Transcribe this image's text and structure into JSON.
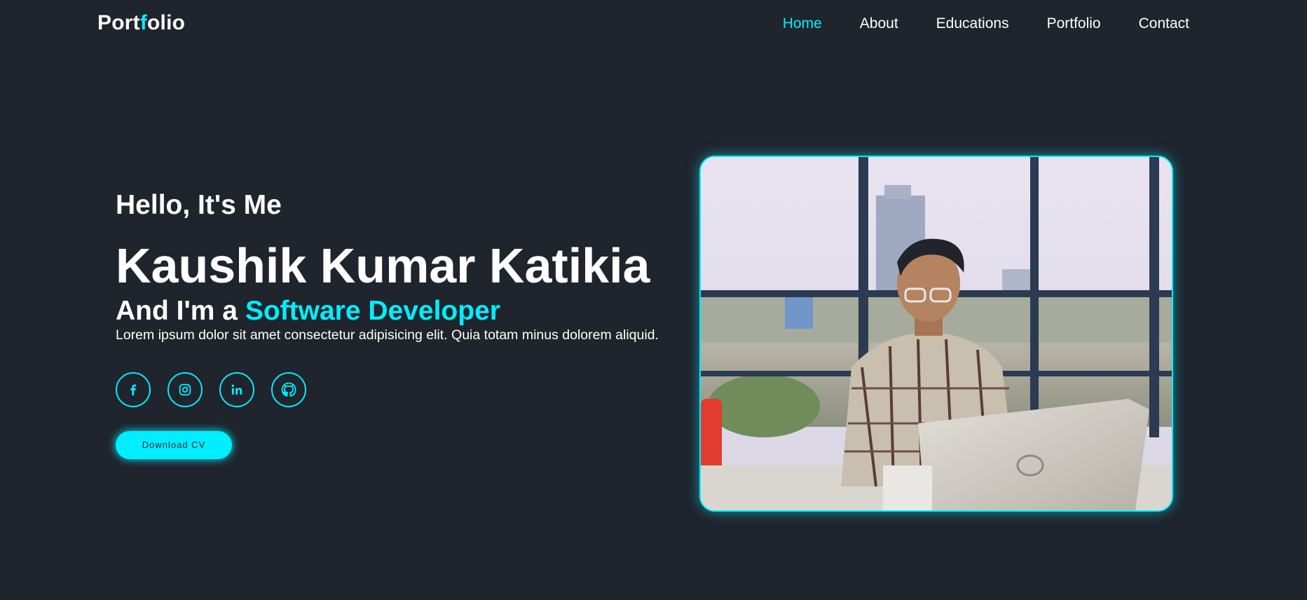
{
  "header": {
    "logo_part1": "Port",
    "logo_accent": "f",
    "logo_part2": "olio",
    "nav": [
      {
        "label": "Home",
        "active": true
      },
      {
        "label": "About",
        "active": false
      },
      {
        "label": "Educations",
        "active": false
      },
      {
        "label": "Portfolio",
        "active": false
      },
      {
        "label": "Contact",
        "active": false
      }
    ]
  },
  "hero": {
    "greeting": "Hello, It's Me",
    "name": "Kaushik Kumar Katikia",
    "role_prefix": "And I'm a",
    "role_highlight": "Software Developer",
    "description": "Lorem ipsum dolor sit amet consectetur adipisicing elit. Quia totam minus dolorem aliquid.",
    "socials": [
      {
        "icon": "facebook-icon"
      },
      {
        "icon": "instagram-icon"
      },
      {
        "icon": "linkedin-icon"
      },
      {
        "icon": "github-icon"
      }
    ],
    "cta_label": "Download CV"
  },
  "theme": {
    "background": "#1f242d",
    "accent": "#00eeff",
    "text": "#ffffff"
  }
}
